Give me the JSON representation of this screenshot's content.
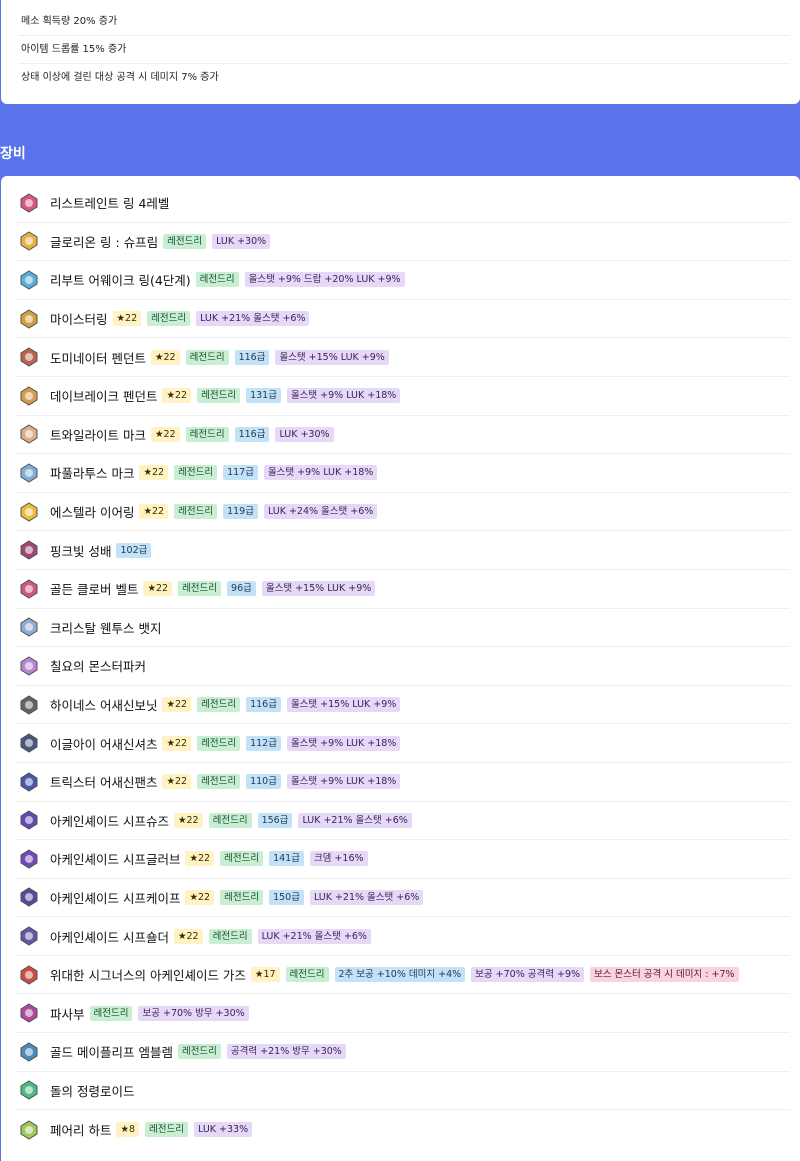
{
  "effects": [
    "메소 획득량 20% 증가",
    "아이템 드롭률 15% 증가",
    "상태 이상에 걸린 대상 공격 시 데미지 7% 증가"
  ],
  "section_title": "장비",
  "items": [
    {
      "name": "리스트레인트 링 4레벨",
      "icon": "ring-icon",
      "color": "#d23a6b",
      "tags": []
    },
    {
      "name": "글로리온 링 : 슈프림",
      "icon": "gold-ring-icon",
      "color": "#e2a520",
      "tags": [
        {
          "t": "grade",
          "v": "레전드리"
        },
        {
          "t": "opt",
          "v": "LUK +30%"
        }
      ]
    },
    {
      "name": "리부트 어웨이크 링(4단계)",
      "icon": "blue-ring-icon",
      "color": "#3aa0d8",
      "tags": [
        {
          "t": "grade",
          "v": "레전드리"
        },
        {
          "t": "opt",
          "v": "올스탯 +9% 드랍 +20% LUK +9%"
        }
      ]
    },
    {
      "name": "마이스터링",
      "icon": "meister-ring-icon",
      "color": "#c99020",
      "tags": [
        {
          "t": "star",
          "v": "★22"
        },
        {
          "t": "grade",
          "v": "레전드리"
        },
        {
          "t": "opt",
          "v": "LUK +21% 올스탯 +6%"
        }
      ]
    },
    {
      "name": "도미네이터 펜던트",
      "icon": "pendant-icon",
      "color": "#b04a2a",
      "tags": [
        {
          "t": "star",
          "v": "★22"
        },
        {
          "t": "grade",
          "v": "레전드리"
        },
        {
          "t": "level",
          "v": "116급"
        },
        {
          "t": "opt",
          "v": "올스탯 +15% LUK +9%"
        }
      ]
    },
    {
      "name": "데이브레이크 펜던트",
      "icon": "daybreak-pendant-icon",
      "color": "#d08a30",
      "tags": [
        {
          "t": "star",
          "v": "★22"
        },
        {
          "t": "grade",
          "v": "레전드리"
        },
        {
          "t": "level",
          "v": "131급"
        },
        {
          "t": "opt",
          "v": "올스탯 +9% LUK +18%"
        }
      ]
    },
    {
      "name": "트와일라이트 마크",
      "icon": "face-mark-icon",
      "color": "#d8a070",
      "tags": [
        {
          "t": "star",
          "v": "★22"
        },
        {
          "t": "grade",
          "v": "레전드리"
        },
        {
          "t": "level",
          "v": "116급"
        },
        {
          "t": "opt",
          "v": "LUK +30%"
        }
      ]
    },
    {
      "name": "파풀라투스 마크",
      "icon": "eye-mark-icon",
      "color": "#6aa0d0",
      "tags": [
        {
          "t": "star",
          "v": "★22"
        },
        {
          "t": "grade",
          "v": "레전드리"
        },
        {
          "t": "level",
          "v": "117급"
        },
        {
          "t": "opt",
          "v": "올스탯 +9% LUK +18%"
        }
      ]
    },
    {
      "name": "에스텔라 이어링",
      "icon": "earring-icon",
      "color": "#e8b020",
      "tags": [
        {
          "t": "star",
          "v": "★22"
        },
        {
          "t": "grade",
          "v": "레전드리"
        },
        {
          "t": "level",
          "v": "119급"
        },
        {
          "t": "opt",
          "v": "LUK +24% 올스탯 +6%"
        }
      ]
    },
    {
      "name": "핑크빛 성배",
      "icon": "chalice-icon",
      "color": "#8a2a5a",
      "tags": [
        {
          "t": "level",
          "v": "102급"
        }
      ]
    },
    {
      "name": "골든 클로버 벨트",
      "icon": "belt-icon",
      "color": "#c83a6a",
      "tags": [
        {
          "t": "star",
          "v": "★22"
        },
        {
          "t": "grade",
          "v": "레전드리"
        },
        {
          "t": "level",
          "v": "96급"
        },
        {
          "t": "opt",
          "v": "올스탯 +15% LUK +9%"
        }
      ]
    },
    {
      "name": "크리스탈 웬투스 뱃지",
      "icon": "badge-icon",
      "color": "#7aa0c8",
      "tags": []
    },
    {
      "name": "칠요의 몬스터파커",
      "icon": "pocket-icon",
      "color": "#b070d0",
      "tags": []
    },
    {
      "name": "하이네스 어새신보닛",
      "icon": "hat-icon",
      "color": "#4a4a4a",
      "tags": [
        {
          "t": "star",
          "v": "★22"
        },
        {
          "t": "grade",
          "v": "레전드리"
        },
        {
          "t": "level",
          "v": "116급"
        },
        {
          "t": "opt",
          "v": "올스탯 +15% LUK +9%"
        }
      ]
    },
    {
      "name": "이글아이 어새신셔츠",
      "icon": "shirt-icon",
      "color": "#2a3a6a",
      "tags": [
        {
          "t": "star",
          "v": "★22"
        },
        {
          "t": "grade",
          "v": "레전드리"
        },
        {
          "t": "level",
          "v": "112급"
        },
        {
          "t": "opt",
          "v": "올스탯 +9% LUK +18%"
        }
      ]
    },
    {
      "name": "트릭스터 어새신팬츠",
      "icon": "pants-icon",
      "color": "#2a3aa0",
      "tags": [
        {
          "t": "star",
          "v": "★22"
        },
        {
          "t": "grade",
          "v": "레전드리"
        },
        {
          "t": "level",
          "v": "110급"
        },
        {
          "t": "opt",
          "v": "올스탯 +9% LUK +18%"
        }
      ]
    },
    {
      "name": "아케인셰이드 시프슈즈",
      "icon": "shoes-icon",
      "color": "#4a2aa0",
      "tags": [
        {
          "t": "star",
          "v": "★22"
        },
        {
          "t": "grade",
          "v": "레전드리"
        },
        {
          "t": "level",
          "v": "156급"
        },
        {
          "t": "opt",
          "v": "LUK +21% 올스탯 +6%"
        }
      ]
    },
    {
      "name": "아케인셰이드 시프글러브",
      "icon": "glove-icon",
      "color": "#5a2ab0",
      "tags": [
        {
          "t": "star",
          "v": "★22"
        },
        {
          "t": "grade",
          "v": "레전드리"
        },
        {
          "t": "level",
          "v": "141급"
        },
        {
          "t": "opt",
          "v": "크뎀 +16%"
        }
      ]
    },
    {
      "name": "아케인셰이드 시프케이프",
      "icon": "cape-icon",
      "color": "#3a2a8a",
      "tags": [
        {
          "t": "star",
          "v": "★22"
        },
        {
          "t": "grade",
          "v": "레전드리"
        },
        {
          "t": "level",
          "v": "150급"
        },
        {
          "t": "opt",
          "v": "LUK +21% 올스탯 +6%"
        }
      ]
    },
    {
      "name": "아케인셰이드 시프숄더",
      "icon": "shoulder-icon",
      "color": "#4a3a9a",
      "tags": [
        {
          "t": "star",
          "v": "★22"
        },
        {
          "t": "grade",
          "v": "레전드리"
        },
        {
          "t": "opt",
          "v": "LUK +21% 올스탯 +6%"
        }
      ]
    },
    {
      "name": "위대한 시그너스의 아케인셰이드 가즈",
      "icon": "weapon-icon",
      "color": "#c03020",
      "tags": [
        {
          "t": "star",
          "v": "★17"
        },
        {
          "t": "grade",
          "v": "레전드리"
        },
        {
          "t": "level",
          "v": "2추 보공 +10% 데미지 +4%"
        },
        {
          "t": "opt",
          "v": "보공 +70% 공격력 +9%"
        },
        {
          "t": "pink",
          "v": "보스 몬스터 공격 시 데미지 : +7%"
        }
      ]
    },
    {
      "name": "파사부",
      "icon": "talisman-icon",
      "color": "#a02a8a",
      "tags": [
        {
          "t": "grade",
          "v": "레전드리"
        },
        {
          "t": "opt",
          "v": "보공 +70% 방무 +30%"
        }
      ]
    },
    {
      "name": "골드 메이플리프 엠블렘",
      "icon": "emblem-icon",
      "color": "#2a7ab0",
      "tags": [
        {
          "t": "grade",
          "v": "레전드리"
        },
        {
          "t": "opt",
          "v": "공격력 +21% 방무 +30%"
        }
      ]
    },
    {
      "name": "돌의 정령로이드",
      "icon": "heart-orb-icon",
      "color": "#30b070",
      "tags": []
    },
    {
      "name": "페어리 하트",
      "icon": "fairy-heart-icon",
      "color": "#8ac040",
      "tags": [
        {
          "t": "star",
          "v": "★8"
        },
        {
          "t": "grade",
          "v": "레전드리"
        },
        {
          "t": "opt",
          "v": "LUK +33%"
        }
      ]
    }
  ]
}
